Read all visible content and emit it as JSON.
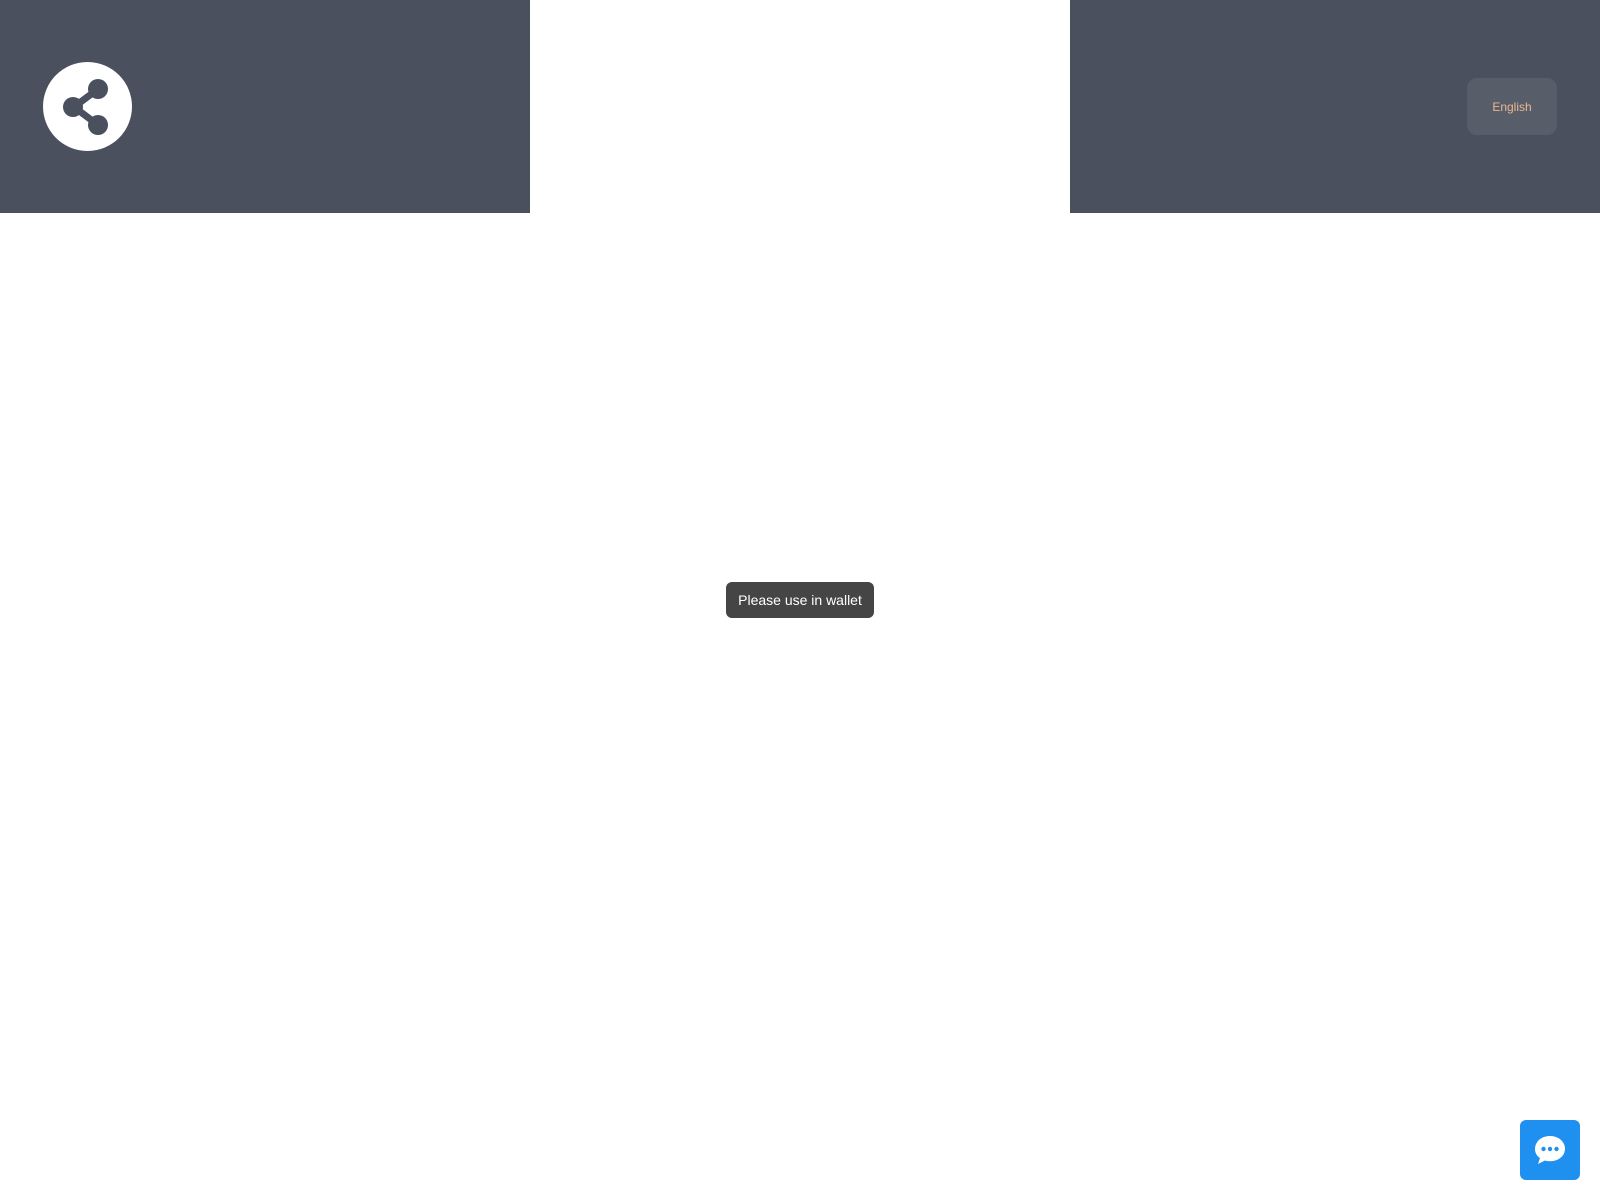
{
  "header": {
    "share_icon": "share-icon",
    "language_label": "English"
  },
  "toast": {
    "message": "Please use in wallet"
  },
  "chat": {
    "icon": "chat-bubble-icon"
  },
  "colors": {
    "header_bg": "#4a505e",
    "language_button_bg": "#585d6a",
    "language_text": "#e8b98f",
    "toast_bg": "#454545",
    "chat_button_bg": "#1f8ff0"
  }
}
